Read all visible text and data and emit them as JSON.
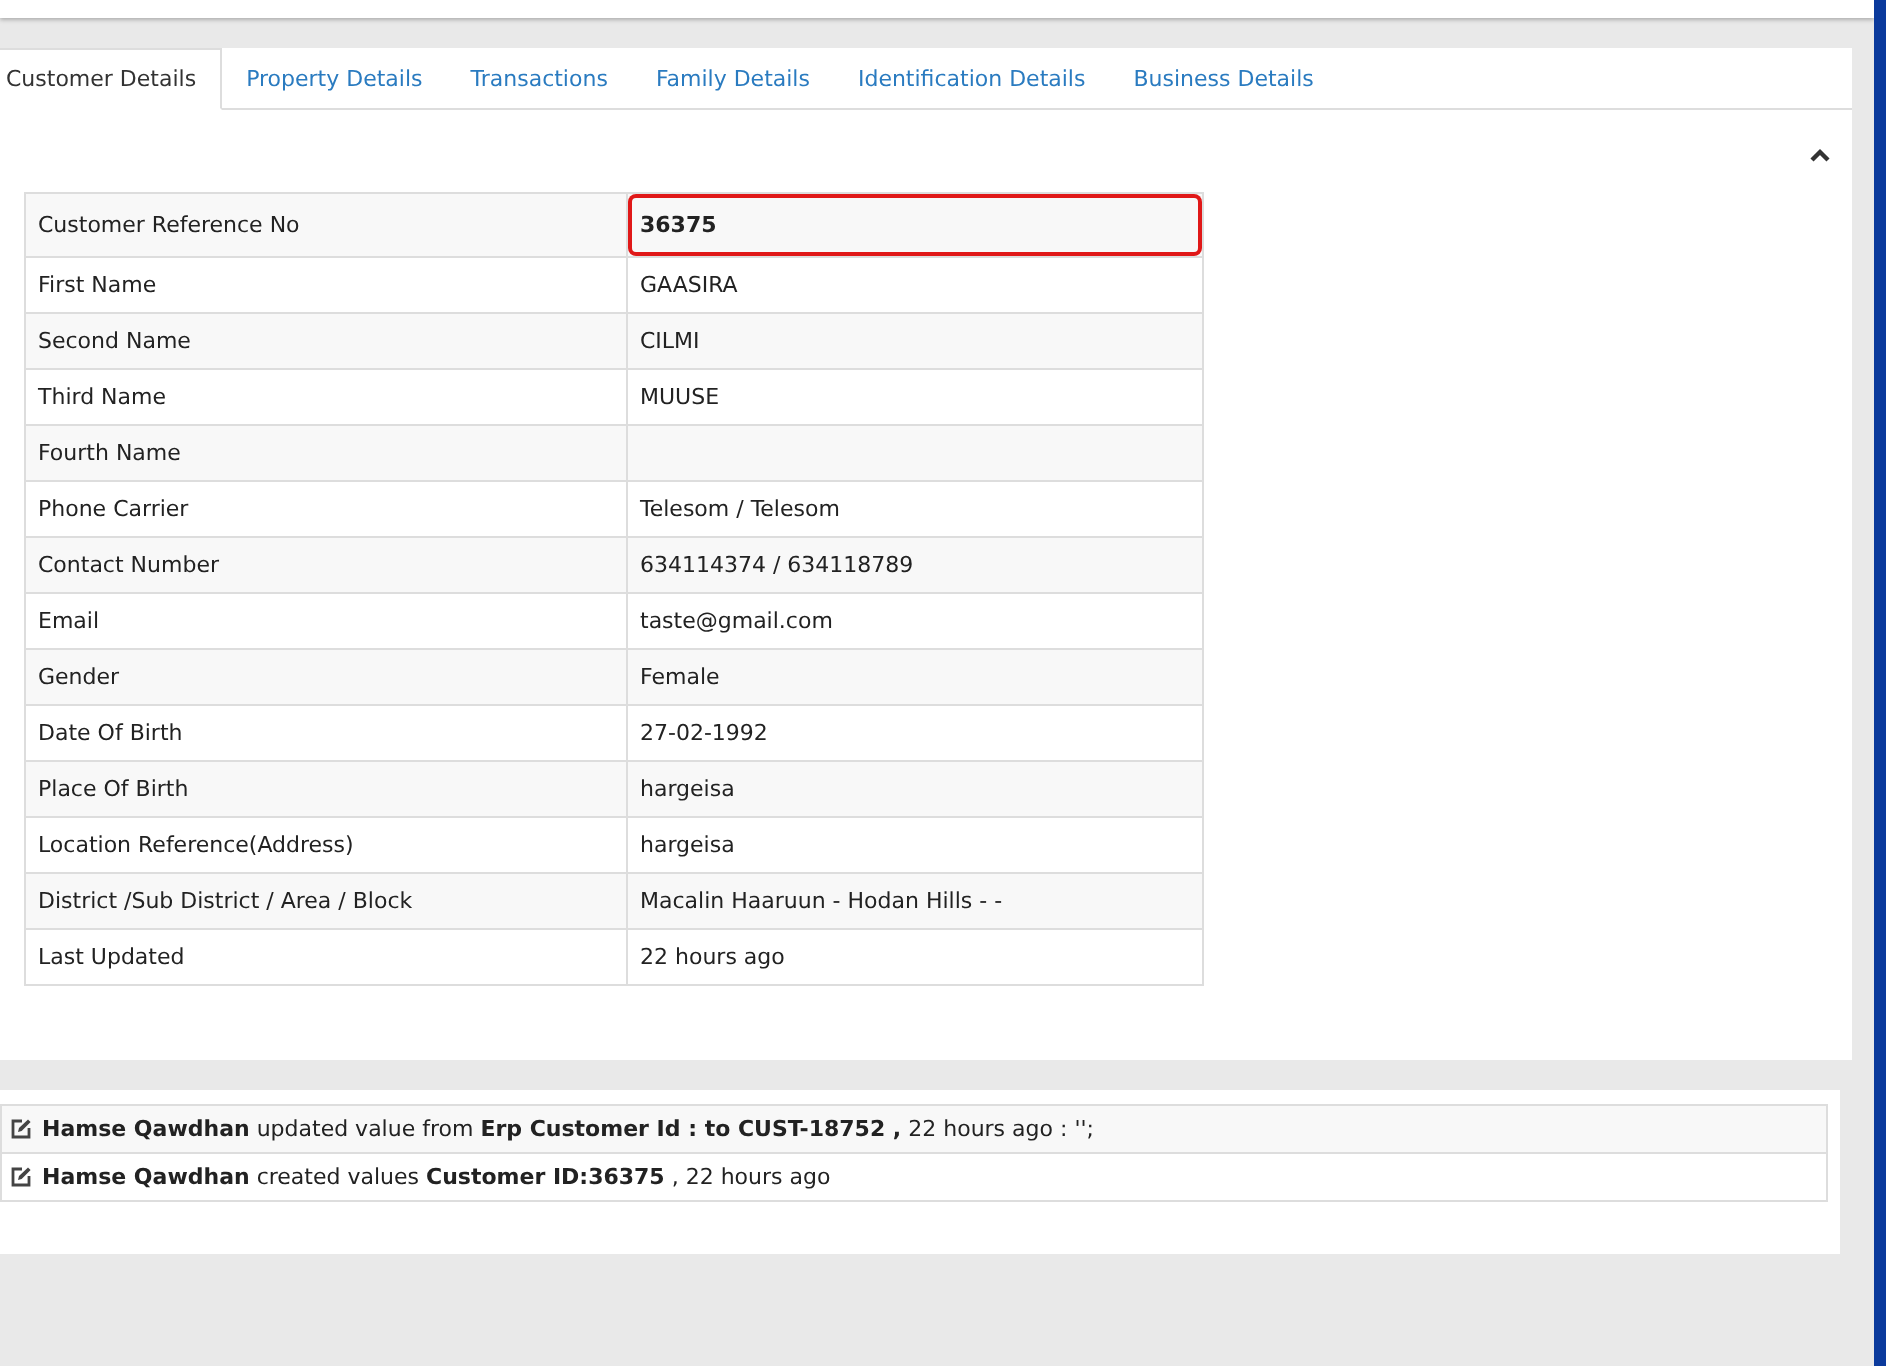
{
  "tabs": [
    {
      "label": "Customer Details",
      "selected": true
    },
    {
      "label": "Property Details",
      "selected": false
    },
    {
      "label": "Transactions",
      "selected": false
    },
    {
      "label": "Family Details",
      "selected": false
    },
    {
      "label": "Identification Details",
      "selected": false
    },
    {
      "label": "Business Details",
      "selected": false
    }
  ],
  "panel": {
    "expanded": true
  },
  "details": [
    {
      "label": "Customer Reference No",
      "value": "36375",
      "highlighted": true
    },
    {
      "label": "First Name",
      "value": "GAASIRA",
      "highlighted": false
    },
    {
      "label": "Second Name",
      "value": "CILMI",
      "highlighted": false
    },
    {
      "label": "Third Name",
      "value": "MUUSE",
      "highlighted": false
    },
    {
      "label": "Fourth Name",
      "highlighted": false
    },
    {
      "label": "Phone Carrier",
      "value": "Telesom / Telesom",
      "highlighted": false
    },
    {
      "label": "Contact Number",
      "value": "634114374 / 634118789",
      "highlighted": false
    },
    {
      "label": "Email",
      "value": "taste@gmail.com",
      "highlighted": false
    },
    {
      "label": "Gender",
      "value": "Female",
      "highlighted": false
    },
    {
      "label": "Date Of Birth",
      "value": "27-02-1992",
      "highlighted": false
    },
    {
      "label": "Place Of Birth",
      "value": "hargeisa",
      "highlighted": false
    },
    {
      "label": "Location Reference(Address)",
      "value": "hargeisa",
      "highlighted": false
    },
    {
      "label": "District /Sub District / Area / Block",
      "value": "Macalin Haaruun - Hodan Hills - -",
      "highlighted": false
    },
    {
      "label": "Last Updated",
      "value": "22 hours ago",
      "highlighted": false
    }
  ],
  "activity_log": [
    {
      "text": "**Hamse Qawdhan** updated value from **Erp Customer Id : to CUST-18752 ,** 22 hours ago : '';"
    },
    {
      "text": "**Hamse Qawdhan** created values **Customer ID:36375** , 22 hours ago"
    }
  ]
}
